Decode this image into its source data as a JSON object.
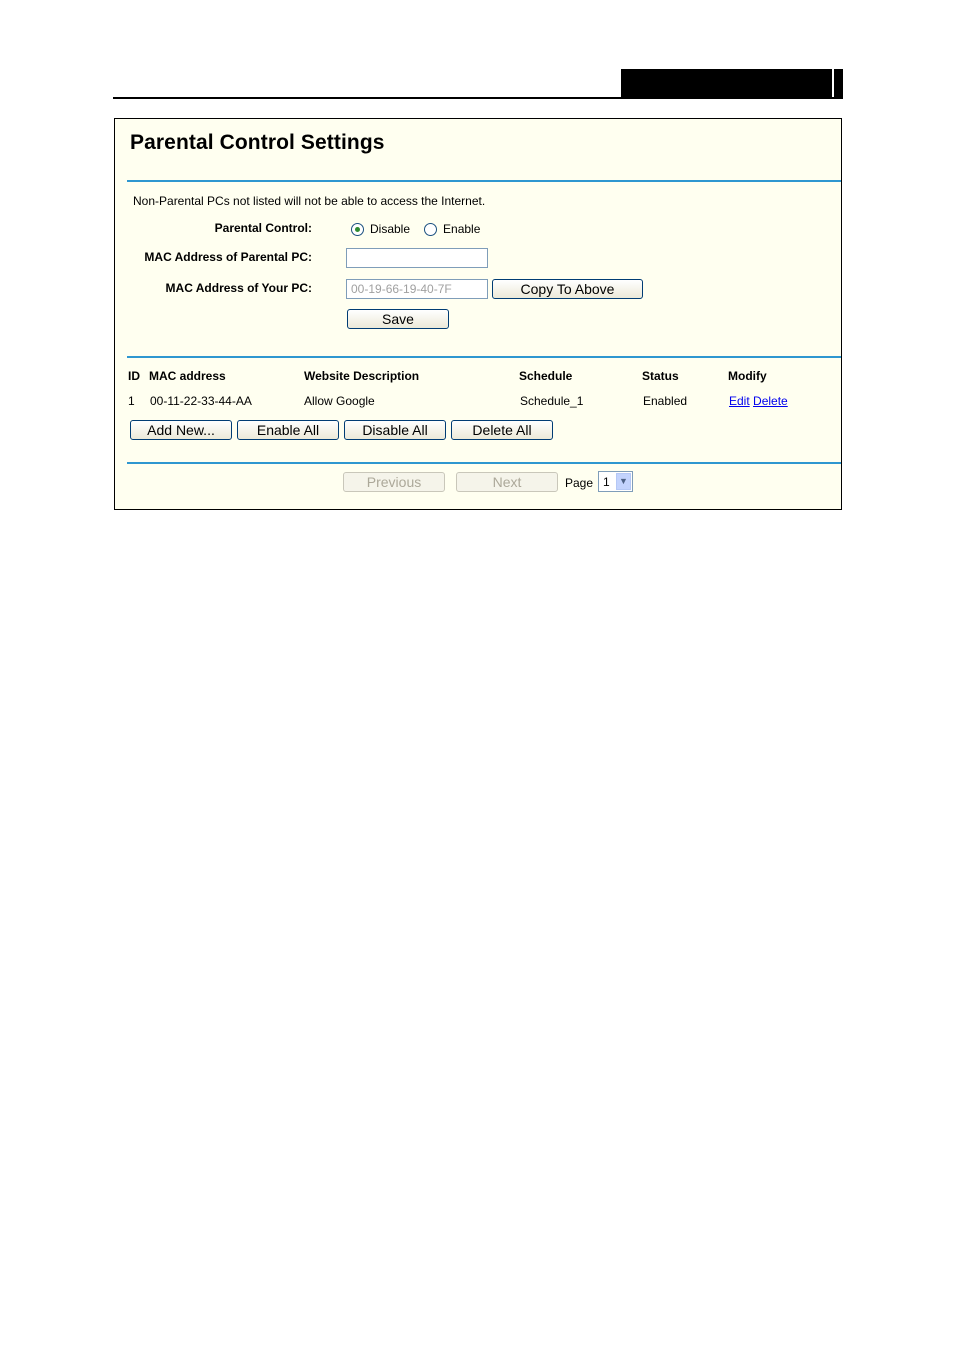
{
  "page": {
    "title": "Parental Control Settings",
    "note": "Non-Parental PCs not listed will not be able to access the Internet."
  },
  "form": {
    "parental_control_label": "Parental Control:",
    "radio_disable": "Disable",
    "radio_enable": "Enable",
    "selected": "Disable",
    "mac_parental_label": "MAC Address of Parental PC:",
    "mac_parental_value": "",
    "mac_your_label": "MAC Address of Your PC:",
    "mac_your_value": "00-19-66-19-40-7F",
    "copy_button": "Copy To Above",
    "save_button": "Save"
  },
  "table": {
    "headers": [
      "ID",
      "MAC address",
      "Website Description",
      "Schedule",
      "Status",
      "Modify"
    ],
    "rows": [
      {
        "id": "1",
        "mac": "00-11-22-33-44-AA",
        "desc": "Allow Google",
        "schedule": "Schedule_1",
        "status": "Enabled",
        "edit": "Edit",
        "delete": "Delete"
      }
    ]
  },
  "actions": {
    "add_new": "Add New...",
    "enable_all": "Enable All",
    "disable_all": "Disable All",
    "delete_all": "Delete All"
  },
  "pager": {
    "previous": "Previous",
    "next": "Next",
    "page_label": "Page",
    "page_value": "1"
  }
}
